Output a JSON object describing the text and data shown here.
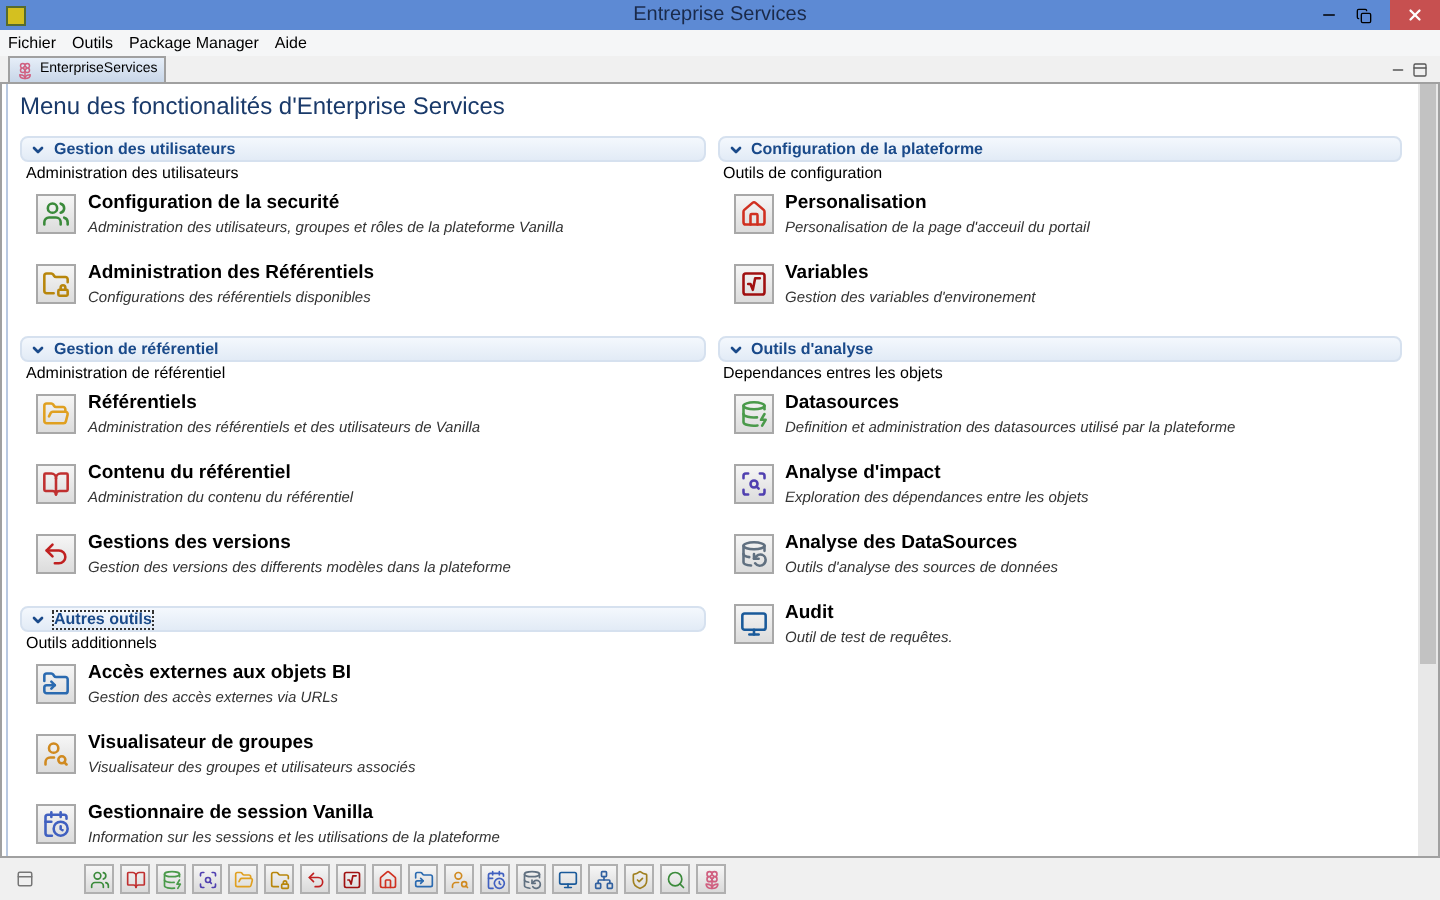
{
  "window": {
    "title": "Entreprise Services"
  },
  "menu": [
    "Fichier",
    "Outils",
    "Package Manager",
    "Aide"
  ],
  "tabs": [
    {
      "label": "EnterpriseServices",
      "selected": true
    }
  ],
  "page_title": "Menu des fonctionalités d'Enterprise Services",
  "columns": [
    {
      "sections": [
        {
          "title": "Gestion des utilisateurs",
          "subtitle": "Administration des utilisateurs",
          "expanded": true,
          "focused": false,
          "items": [
            {
              "title": "Configuration de la securité",
              "description": "Administration des utilisateurs, groupes et rôles de la plateforme Vanilla"
            },
            {
              "title": "Administration des Référentiels",
              "description": "Configurations des référentiels disponibles"
            }
          ]
        },
        {
          "title": "Gestion de référentiel",
          "subtitle": "Administration de référentiel",
          "expanded": true,
          "focused": false,
          "items": [
            {
              "title": "Référentiels",
              "description": "Administration des référentiels et des utilisateurs de Vanilla"
            },
            {
              "title": "Contenu du référentiel",
              "description": "Administration du contenu du référentiel"
            },
            {
              "title": "Gestions des versions",
              "description": "Gestion des versions des differents modèles dans la plateforme"
            }
          ]
        },
        {
          "title": "Autres outils",
          "subtitle": "Outils additionnels",
          "expanded": true,
          "focused": true,
          "items": [
            {
              "title": "Accès externes aux objets BI",
              "description": "Gestion des accès externes via URLs"
            },
            {
              "title": "Visualisateur de groupes",
              "description": "Visualisateur des groupes et utilisateurs associés"
            },
            {
              "title": "Gestionnaire de session Vanilla",
              "description": "Information sur les sessions et les utilisations de la plateforme"
            }
          ]
        }
      ]
    },
    {
      "sections": [
        {
          "title": "Configuration de la plateforme",
          "subtitle": "Outils de configuration",
          "expanded": true,
          "focused": false,
          "items": [
            {
              "title": "Personalisation",
              "description": "Personalisation de la page d'acceuil du portail"
            },
            {
              "title": "Variables",
              "description": "Gestion des variables d'environement"
            }
          ]
        },
        {
          "title": "Outils d'analyse",
          "subtitle": "Dependances entres les objets",
          "expanded": true,
          "focused": false,
          "items": [
            {
              "title": "Datasources",
              "description": "Definition et administration des datasources utilisé par la plateforme"
            },
            {
              "title": "Analyse d'impact",
              "description": "Exploration des dépendances entre les objets"
            },
            {
              "title": "Analyse des DataSources",
              "description": "Outils d'analyse des sources de données"
            },
            {
              "title": "Audit",
              "description": "Outil de test de requêtes."
            }
          ]
        }
      ]
    }
  ]
}
